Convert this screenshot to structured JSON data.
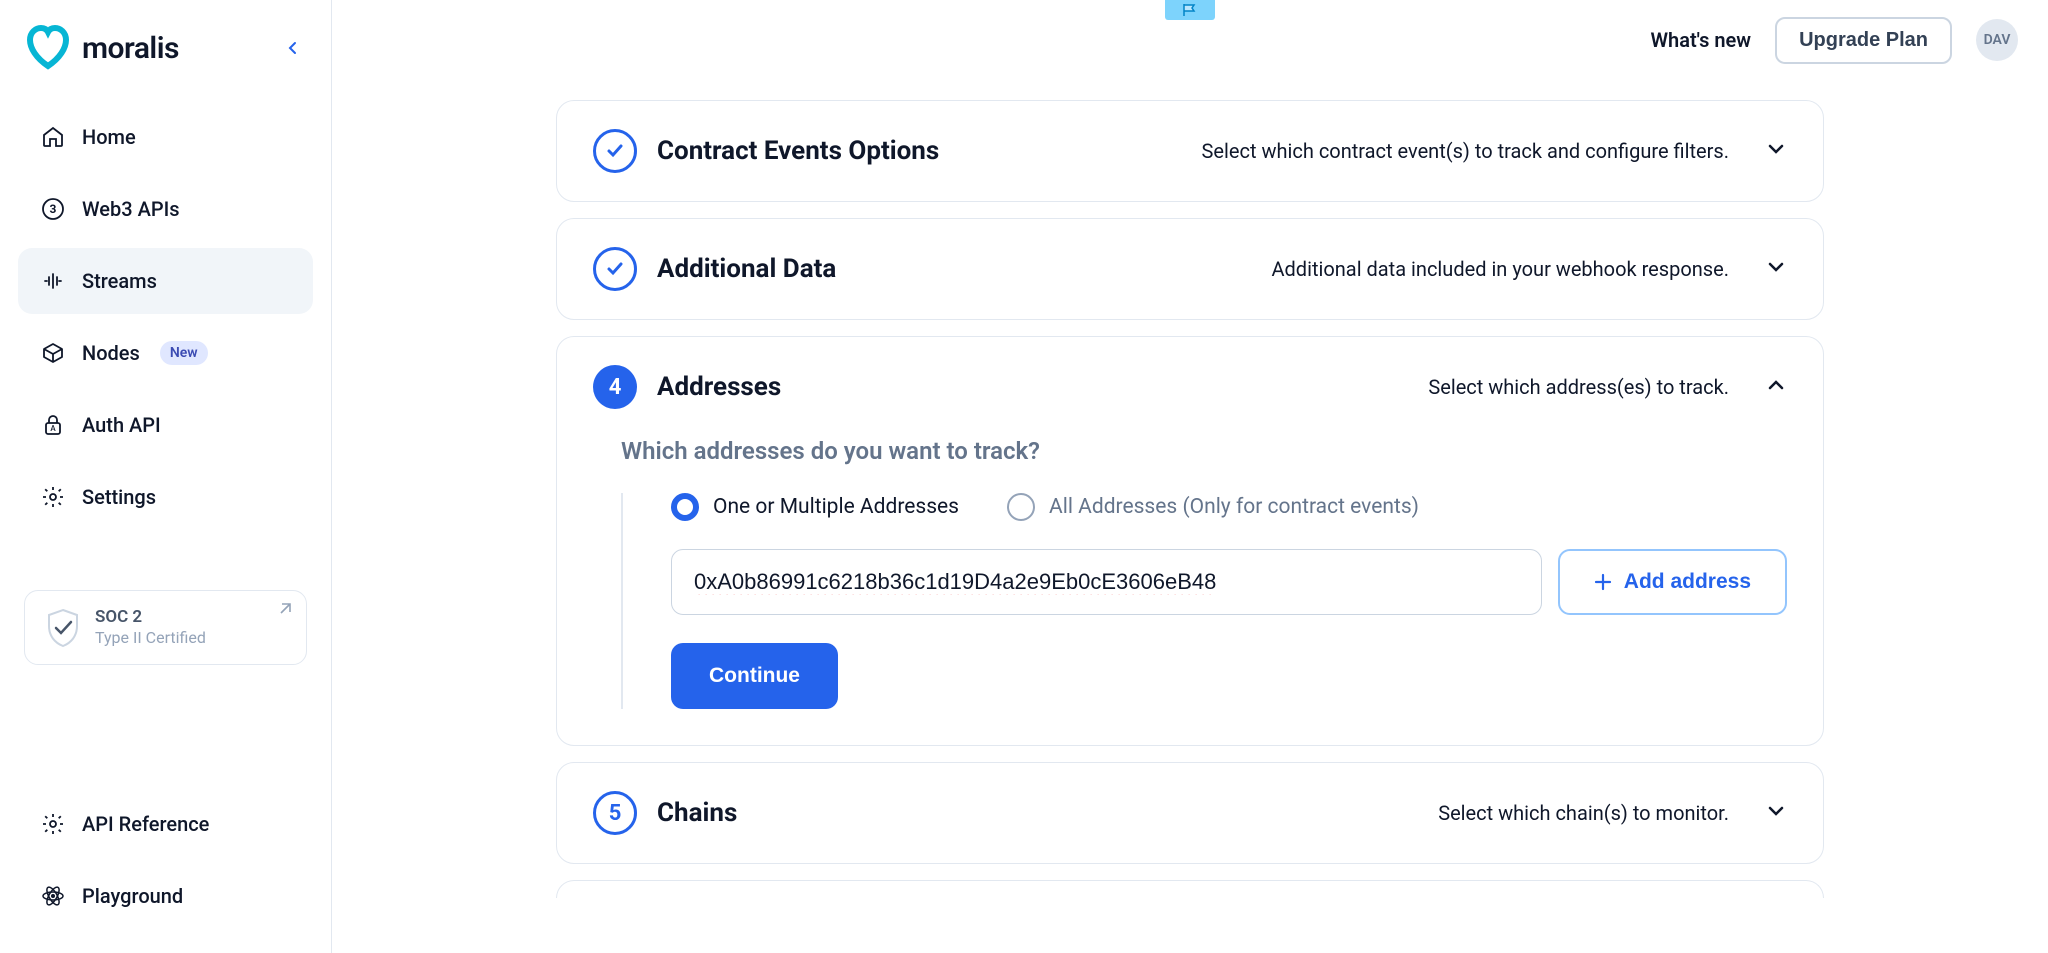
{
  "brand": {
    "name": "moralis"
  },
  "topbar": {
    "whats_new": "What's new",
    "upgrade": "Upgrade Plan",
    "avatar_initials": "DAV"
  },
  "sidebar": {
    "items": [
      {
        "label": "Home"
      },
      {
        "label": "Web3 APIs"
      },
      {
        "label": "Streams"
      },
      {
        "label": "Nodes",
        "badge": "New"
      },
      {
        "label": "Auth API"
      },
      {
        "label": "Settings"
      }
    ],
    "soc": {
      "title": "SOC 2",
      "sub": "Type II Certified"
    },
    "bottom": [
      {
        "label": "API Reference"
      },
      {
        "label": "Playground"
      }
    ]
  },
  "panels": {
    "contract_events": {
      "title": "Contract Events Options",
      "sub": "Select which contract event(s) to track and configure filters."
    },
    "additional_data": {
      "title": "Additional Data",
      "sub": "Additional data included in your webhook response."
    },
    "addresses": {
      "step": "4",
      "title": "Addresses",
      "sub": "Select which address(es) to track.",
      "question": "Which addresses do you want to track?",
      "radio_one": "One or Multiple Addresses",
      "radio_all": "All Addresses (Only for contract events)",
      "input_value": "0xA0b86991c6218b36c1d19D4a2e9Eb0cE3606eB48",
      "add_address": "Add address",
      "continue": "Continue"
    },
    "chains": {
      "step": "5",
      "title": "Chains",
      "sub": "Select which chain(s) to monitor."
    }
  }
}
